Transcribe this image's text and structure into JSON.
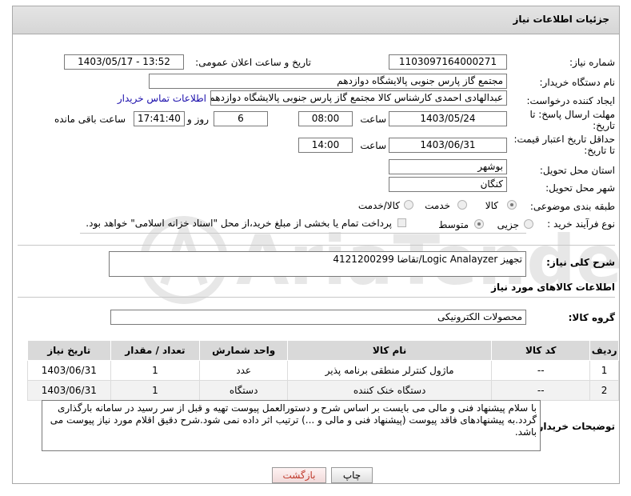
{
  "header": {
    "title": "جزئیات اطلاعات نیاز"
  },
  "need_number": {
    "label": "شماره نیاز:",
    "value": "1103097164000271"
  },
  "announce": {
    "label": "تاریخ و ساعت اعلان عمومی:",
    "value": "1403/05/17 - 13:52"
  },
  "buyer_org": {
    "label": "نام دستگاه خریدار:",
    "value": "مجتمع گاز پارس جنوبی  پالایشگاه دوازدهم"
  },
  "requester": {
    "label": "ایجاد کننده درخواست:",
    "value": "عبدالهادی احمدی کارشناس کالا مجتمع گاز پارس جنوبی  پالایشگاه دوازدهم",
    "contact_link": "اطلاعات تماس خریدار"
  },
  "deadline": {
    "label": "مهلت ارسال پاسخ: تا تاریخ:",
    "date": "1403/05/24",
    "time_label": "ساعت",
    "time": "08:00",
    "days": "6",
    "days_label": "روز و",
    "remaining": "17:41:40",
    "remaining_label": "ساعت باقی مانده"
  },
  "validity": {
    "label": "حداقل تاریخ اعتبار قیمت: تا تاریخ:",
    "date": "1403/06/31",
    "time_label": "ساعت",
    "time": "14:00"
  },
  "province": {
    "label": "استان محل تحویل:",
    "value": "بوشهر"
  },
  "city": {
    "label": "شهر محل تحویل:",
    "value": "کنگان"
  },
  "category": {
    "label": "طبقه بندی موضوعی:",
    "options": [
      "کالا",
      "خدمت",
      "کالا/خدمت"
    ],
    "selected": "کالا"
  },
  "process": {
    "label": "نوع فرآیند خرید :",
    "options": [
      "جزیی",
      "متوسط"
    ],
    "selected": "متوسط",
    "note": "پرداخت تمام یا بخشی از مبلغ خرید،از محل \"اسناد خزانه اسلامی\" خواهد بود."
  },
  "description": {
    "label": "شرح کلی نیاز:",
    "value": "تجهیز Logic Analayzer/تقاضا 4121200299"
  },
  "goods_info": {
    "title": "اطلاعات کالاهای مورد نیاز"
  },
  "goods_group": {
    "label": "گروه کالا:",
    "value": "محصولات الکترونیکی"
  },
  "table": {
    "headers": [
      "ردیف",
      "کد کالا",
      "نام کالا",
      "واحد شمارش",
      "تعداد / مقدار",
      "تاریخ نیاز"
    ],
    "rows": [
      [
        "1",
        "--",
        "ماژول کنترلر منطقی برنامه پذیر",
        "عدد",
        "1",
        "1403/06/31"
      ],
      [
        "2",
        "--",
        "دستگاه خنک کننده",
        "دستگاه",
        "1",
        "1403/06/31"
      ]
    ]
  },
  "buyer_notes": {
    "label": "توضیحات خریدار:",
    "value": "با سلام پیشنهاد فنی و مالی می بایست بر اساس شرح و دستورالعمل پیوست تهیه و قبل از سر رسید در سامانه بارگذاری گردد.به پیشنهادهای فاقد پیوست (پیشنهاد فنی و مالی و ...) ترتیب اثر داده نمی شود.شرح دقیق اقلام مورد نیاز پیوست می باشد."
  },
  "buttons": {
    "print": "چاپ",
    "back": "بازگشت"
  },
  "watermark": "AriaTender.neT",
  "colors": {
    "link": "#1a0dab",
    "back_text": "#c0392b",
    "header_bg": "#dcdcdc"
  }
}
